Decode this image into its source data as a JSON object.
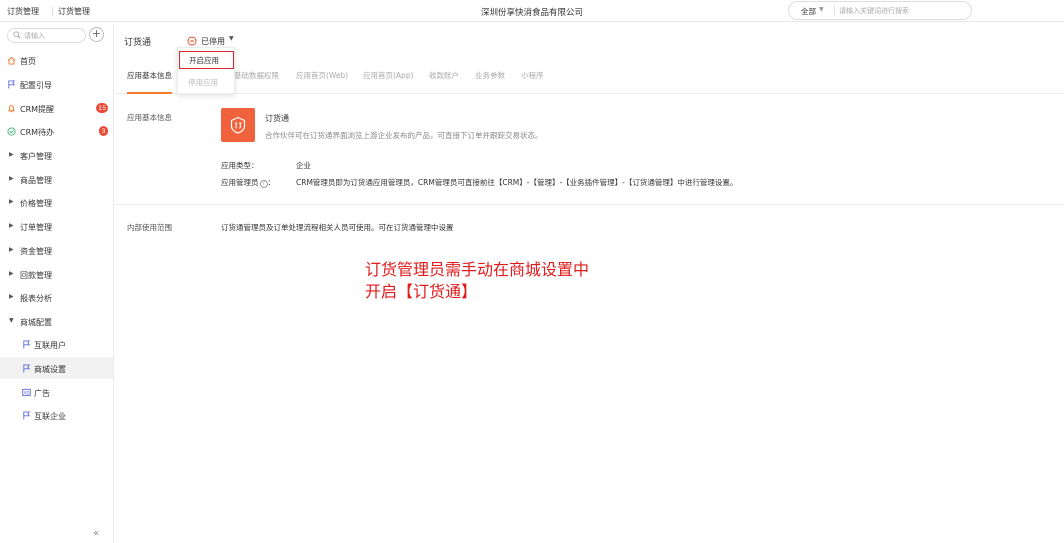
{
  "header": {
    "breadcrumb": [
      "订货管理",
      "订货管理"
    ],
    "separator": "|",
    "company": "深圳份享快消食品有限公司",
    "search": {
      "scope": "全部",
      "placeholder": "请输入关键词进行搜索"
    }
  },
  "sidebar": {
    "search_placeholder": "请输入",
    "items": [
      {
        "label": "首页",
        "icon": "home-icon"
      },
      {
        "label": "配置引导",
        "icon": "flag-icon"
      },
      {
        "label": "CRM提醒",
        "icon": "bell-icon",
        "badge": "15"
      },
      {
        "label": "CRM待办",
        "icon": "check-circle-icon",
        "badge": "3"
      },
      {
        "label": "客户管理"
      },
      {
        "label": "商品管理"
      },
      {
        "label": "价格管理"
      },
      {
        "label": "订单管理"
      },
      {
        "label": "资金管理"
      },
      {
        "label": "回款管理"
      },
      {
        "label": "报表分析"
      },
      {
        "label": "商城配置",
        "expanded": true
      },
      {
        "label": "互联用户",
        "icon": "flag-icon"
      },
      {
        "label": "商城设置",
        "icon": "flag-icon",
        "active": true
      },
      {
        "label": "广告",
        "icon": "ad-icon"
      },
      {
        "label": "互联企业",
        "icon": "flag-icon"
      }
    ],
    "collapse_glyph": "«"
  },
  "main": {
    "app_title": "订货通",
    "status": "已停用",
    "dropdown": {
      "enable": "开启应用",
      "disable": "停用应用"
    },
    "tabs": [
      "应用基本信息",
      "基础数据权限",
      "应用首页(Web)",
      "应用首页(App)",
      "收款账户",
      "业务参数",
      "小程序"
    ],
    "basic_info": {
      "label": "应用基本信息",
      "name": "订货通",
      "description": "合作伙伴可在订货通界面浏览上游企业发布的产品，可直接下订单并跟踪交易状态。",
      "type_label": "应用类型：",
      "type_value": "企业",
      "admin_label": "应用管理员",
      "admin_value": "CRM管理员即为订货通应用管理员，CRM管理员可直接前往【CRM】-【管理】-【业务插件管理】-【订货通管理】中进行管理设置。"
    },
    "internal_scope": {
      "label": "内部使用范围",
      "value": "订货通管理员及订单处理流程相关人员可使用。可在订货通管理中设置"
    },
    "annotation": [
      "订货管理员需手动在商城设置中",
      "开启【订货通】"
    ]
  },
  "colors": {
    "accent": "#f47a2c",
    "app_icon": "#f0623c",
    "badge": "#e84b38",
    "annotation": "#e01b1b",
    "nav_icon": "#5b6bd6"
  }
}
